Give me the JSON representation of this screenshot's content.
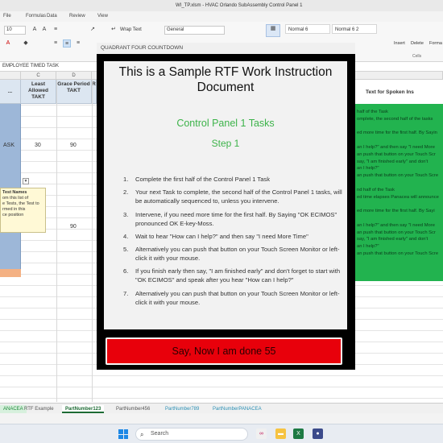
{
  "window": {
    "title": "WI_TP.xlsm  -  HVAC Orlando SubAssembly Control Panel 1"
  },
  "menu": [
    "File",
    "Formulas",
    "Data",
    "Review",
    "View"
  ],
  "ribbon": {
    "font_size": "10",
    "wrap_text": "Wrap Text",
    "number_format": "General",
    "style_normal_6": "Normal 6",
    "style_normal_6_2": "Normal 6 2",
    "cells_group": "Cells",
    "insert": "Insert",
    "delete": "Delete",
    "format": "Forma"
  },
  "formula_bar": {
    "text": "EMPLOYEE TIMED TASK"
  },
  "sheet": {
    "columns": [
      "C",
      "D"
    ],
    "headers": {
      "col_b": "...",
      "col_c": "Least Allowed TAKT",
      "col_d": "Grace Period TAKT",
      "col_e": "R"
    },
    "row1": {
      "task": "ASK",
      "least": "30",
      "grace": "90"
    },
    "row2": {
      "grace": "90"
    },
    "note": {
      "title": "Test Names",
      "lines": [
        "om this list of",
        "e Tests, the Test to",
        "rmed in this",
        "ce position"
      ]
    },
    "right_header": "Text for Spoken Ins",
    "green_lines": [
      "half of the Task",
      "omplete, the second half of the tasks",
      "",
      "ed more time for the first half. By Sayin",
      "",
      "an I help?\" and then say \"I need More",
      "an push that button on your Touch Scr",
      "say, \"I am finished early\" and don't",
      "an I help?\"",
      "an push that button on your Touch Scre",
      "",
      "nd half of the Task",
      "ed time elapses Panacea will announce",
      "",
      "ed more time for the first half. By Sayi",
      "",
      "an I help?\" and then say \"I need More",
      "an push that button on your Touch Scr",
      "say, \"I am finished early\" and don't",
      "an I help?\"",
      "an push that button on your Touch Scre"
    ]
  },
  "sheet_tabs": [
    {
      "label": "ANACEA",
      "style": "green"
    },
    {
      "label": "RTF Example",
      "style": "plain"
    },
    {
      "label": "PartNumber123",
      "style": "active"
    },
    {
      "label": "PartNumber456",
      "style": "plain"
    },
    {
      "label": "PartNumber789",
      "style": "teal"
    },
    {
      "label": "PartNumberPANACEA",
      "style": "teal"
    }
  ],
  "taskbar": {
    "search_placeholder": "Search"
  },
  "dialog": {
    "window_title": "QUADRANT FOUR COUNTDOWN",
    "doc_title": "This is a Sample RTF Work Instruction Document",
    "panel_title": "Control Panel 1 Tasks",
    "step_title": "Step 1",
    "steps": [
      {
        "num": "1.",
        "text": "Complete the first half of the Control Panel 1 Task"
      },
      {
        "num": "2.",
        "text": "Your next Task to complete, the second half of the Control Panel 1 tasks, will be automatically sequenced to, unless you intervene."
      },
      {
        "num": "3.",
        "text": "Intervene, if you need more time for the first half. By Saying \"OK ECIMOS\" pronounced OK E-key-Moss."
      },
      {
        "num": "4.",
        "text": "Wait to hear \"How can I help?\" and then say \"I need More Time\""
      },
      {
        "num": "5.",
        "text": "Alternatively you can push that button on your Touch Screen Monitor or left-click it with your mouse."
      },
      {
        "num": "6.",
        "text": "If you finish early then say, \"I am finished early\" and don't forget to start with \"OK ECIMOS\" and speak after you hear \"How can I help?\""
      },
      {
        "num": "7.",
        "text": "Alternatively you can push that button on your Touch Screen Monitor or left-click it with your mouse."
      }
    ],
    "done_button": "Say, Now I am done 55"
  },
  "colors": {
    "done_button": "#e8000b",
    "panel_title": "#3db34a",
    "green_block": "#22b34f"
  }
}
